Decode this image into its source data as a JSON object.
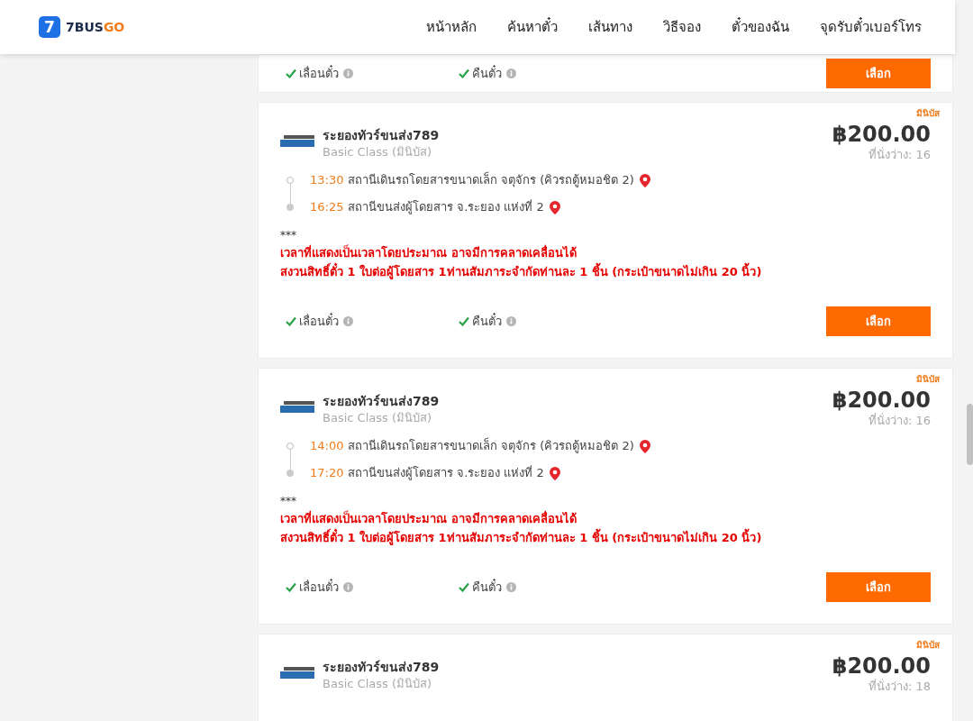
{
  "header": {
    "logo": {
      "mark": "7",
      "name_main": "7BUS",
      "name_accent": "GO"
    },
    "nav": [
      "หน้าหลัก",
      "ค้นหาตั๋ว",
      "เส้นทาง",
      "วิธีจอง",
      "ตั๋วของฉัน",
      "จุดรับตั๋วเบอร์โทร"
    ]
  },
  "trips": [
    {
      "features": [
        {
          "label": "เลื่อนตั๋ว",
          "available": true
        },
        {
          "label": "คืนตั๋ว",
          "available": true
        }
      ],
      "button": "เลือก"
    },
    {
      "badge": "มินิบัส",
      "operator": "ระยองทัวร์ขนส่ง789",
      "class": "Basic Class (มินิบัส)",
      "price": "฿200.00",
      "seats": "ที่นั่งว่าง: 16",
      "stops": [
        {
          "time": "13:30",
          "station": "สถานีเดินรถโดยสารขนาดเล็ก จตุจักร (คิวรถตู้หมอชิต 2)"
        },
        {
          "time": "16:25",
          "station": "สถานีขนส่งผู้โดยสาร จ.ระยอง แห่งที่ 2"
        }
      ],
      "note_mark": "***",
      "notes": [
        "เวลาที่แสดงเป็นเวลาโดยประมาณ อาจมีการคลาดเคลื่อนได้",
        "สงวนสิทธิ์ตั๋ว 1 ใบต่อผู้โดยสาร 1ท่านสัมภาระจำกัดท่านละ 1 ชิ้น (กระเป๋าขนาดไม่เกิน 20 นิ้ว)"
      ],
      "features": [
        {
          "label": "เลื่อนตั๋ว",
          "available": true
        },
        {
          "label": "คืนตั๋ว",
          "available": true
        }
      ],
      "button": "เลือก"
    },
    {
      "badge": "มินิบัส",
      "operator": "ระยองทัวร์ขนส่ง789",
      "class": "Basic Class (มินิบัส)",
      "price": "฿200.00",
      "seats": "ที่นั่งว่าง: 16",
      "stops": [
        {
          "time": "14:00",
          "station": "สถานีเดินรถโดยสารขนาดเล็ก จตุจักร (คิวรถตู้หมอชิต 2)"
        },
        {
          "time": "17:20",
          "station": "สถานีขนส่งผู้โดยสาร จ.ระยอง แห่งที่ 2"
        }
      ],
      "note_mark": "***",
      "notes": [
        "เวลาที่แสดงเป็นเวลาโดยประมาณ อาจมีการคลาดเคลื่อนได้",
        "สงวนสิทธิ์ตั๋ว 1 ใบต่อผู้โดยสาร 1ท่านสัมภาระจำกัดท่านละ 1 ชิ้น (กระเป๋าขนาดไม่เกิน 20 นิ้ว)"
      ],
      "features": [
        {
          "label": "เลื่อนตั๋ว",
          "available": true
        },
        {
          "label": "คืนตั๋ว",
          "available": true
        }
      ],
      "button": "เลือก"
    },
    {
      "badge": "มินิบัส",
      "operator": "ระยองทัวร์ขนส่ง789",
      "class": "Basic Class (มินิบัส)",
      "price": "฿200.00",
      "seats": "ที่นั่งว่าง: 18"
    }
  ]
}
